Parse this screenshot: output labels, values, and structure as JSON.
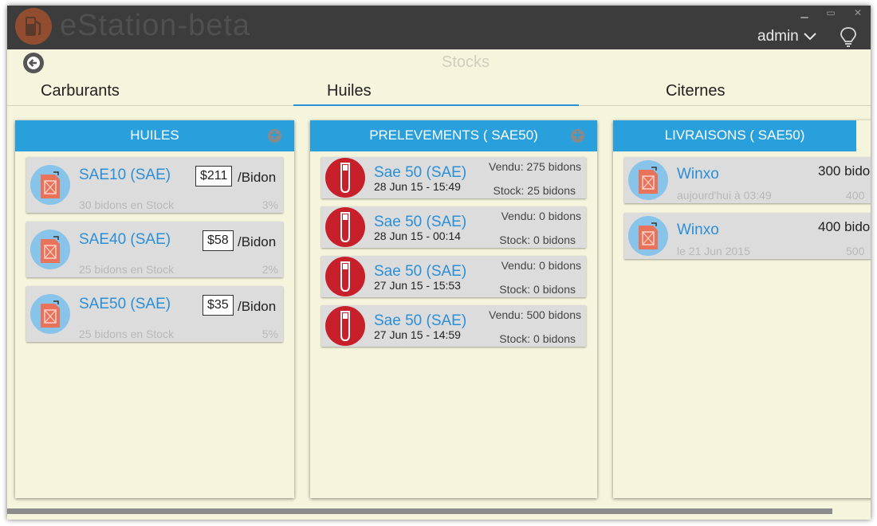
{
  "app": {
    "title": "eStation-beta",
    "user": "admin"
  },
  "page": {
    "title": "Stocks"
  },
  "tabs": [
    {
      "label": "Carburants"
    },
    {
      "label": "Huiles"
    },
    {
      "label": "Citernes"
    }
  ],
  "panels": {
    "huiles": {
      "title": "HUILES",
      "items": [
        {
          "name": "SAE10 (SAE)",
          "price": "$211",
          "unit": "/Bidon",
          "stock": "30 bidons en Stock",
          "percent": "3%"
        },
        {
          "name": "SAE40 (SAE)",
          "price": "$58",
          "unit": "/Bidon",
          "stock": "25 bidons en Stock",
          "percent": "2%"
        },
        {
          "name": "SAE50 (SAE)",
          "price": "$35",
          "unit": "/Bidon",
          "stock": "25 bidons en Stock",
          "percent": "5%"
        }
      ]
    },
    "prelevements": {
      "title": "PRELEVEMENTS ( SAE50)",
      "items": [
        {
          "name": "Sae 50 (SAE)",
          "date": "28 Jun 15 - 15:49",
          "sold": "Vendu: 275 bidons",
          "stock": "Stock: 25 bidons"
        },
        {
          "name": "Sae 50 (SAE)",
          "date": "28 Jun 15 - 00:14",
          "sold": "Vendu: 0 bidons",
          "stock": "Stock: 0 bidons"
        },
        {
          "name": "Sae 50 (SAE)",
          "date": "27 Jun 15 - 15:53",
          "sold": "Vendu: 0 bidons",
          "stock": "Stock: 0 bidons"
        },
        {
          "name": "Sae 50 (SAE)",
          "date": "27 Jun 15 - 14:59",
          "sold": "Vendu: 500 bidons",
          "stock": "Stock: 0 bidons"
        }
      ]
    },
    "livraisons": {
      "title": "LIVRAISONS ( SAE50)",
      "items": [
        {
          "name": "Winxo",
          "date": "aujourd'hui à 03:49",
          "quantity": "300 bido",
          "sub": "400"
        },
        {
          "name": "Winxo",
          "date": "le 21 Jun 2015",
          "quantity": "400 bido",
          "sub": "500"
        }
      ]
    }
  },
  "colors": {
    "accent": "#29a0dc",
    "titlebar": "#3c3c3c",
    "background": "#f5f4dc",
    "card": "#dcdcdc",
    "tube": "#c8202a",
    "canister": "#e8735a"
  }
}
